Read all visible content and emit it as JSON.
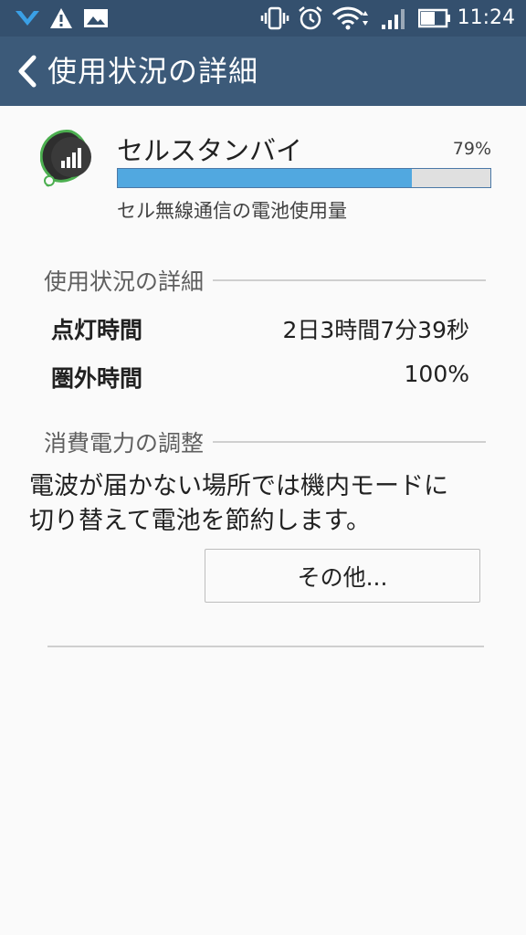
{
  "status_bar": {
    "time": "11:24",
    "icons": [
      "v-notify-icon",
      "warning-icon",
      "image-icon",
      "vibrate-icon",
      "alarm-icon",
      "wifi-icon",
      "signal-icon",
      "battery-icon"
    ]
  },
  "action_bar": {
    "title": "使用状況の詳細"
  },
  "app": {
    "name": "セルスタンバイ",
    "percent": "79%",
    "usage_fraction": 0.79,
    "description": "セル無線通信の電池使用量",
    "icon": "signal-bars-icon"
  },
  "usage_section": {
    "title": "使用状況の詳細",
    "rows": [
      {
        "label": "点灯時間",
        "value": "2日3時間7分39秒"
      },
      {
        "label": "圏外時間",
        "value": "100%"
      }
    ]
  },
  "power_section": {
    "title": "消費電力の調整",
    "description_line1": "電波が届かない場所では機内モードに",
    "description_line2": "切り替えて電池を節約します。",
    "button_label": "その他..."
  },
  "colors": {
    "status_bar": "#34506e",
    "action_bar": "#3c5a79",
    "progress_fill": "#51a8e0",
    "background": "#fafafa"
  }
}
